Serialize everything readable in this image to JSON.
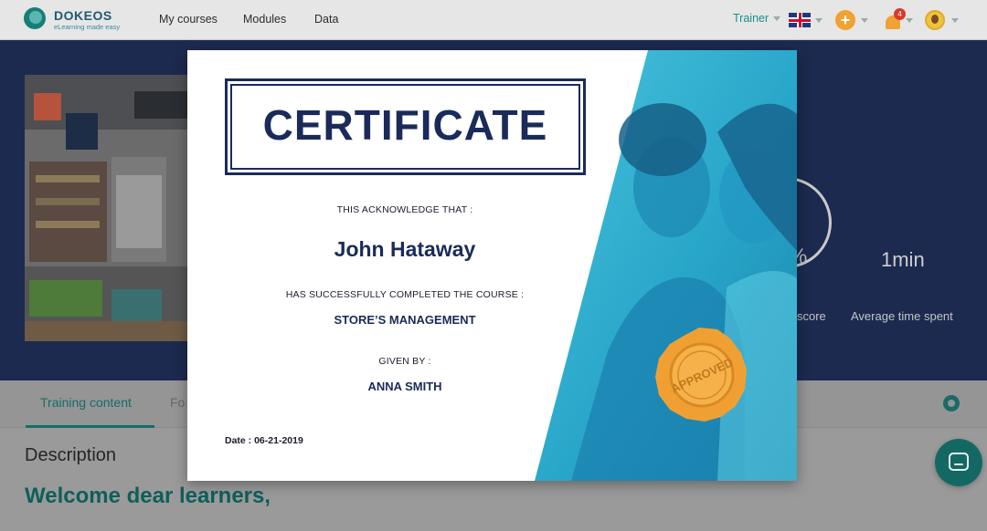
{
  "brand": {
    "name": "DOKEOS",
    "tagline": "eLearning made easy"
  },
  "nav": {
    "links": [
      "My courses",
      "Modules",
      "Data"
    ],
    "role": "Trainer",
    "notifications_count": "4"
  },
  "stats": {
    "score_symbol": "%",
    "score_label": "score",
    "avg_time_value": "1min",
    "avg_time_label": "Average time spent"
  },
  "tabs": {
    "active": "Training content",
    "second": "Fo"
  },
  "content": {
    "description_title": "Description",
    "welcome": "Welcome dear learners,"
  },
  "certificate": {
    "title": "CERTIFICATE",
    "ack_line": "THIS ACKNOWLEDGE THAT :",
    "recipient": "John Hataway",
    "completed_line": "HAS SUCCESSFULLY COMPLETED THE COURSE :",
    "course_name": "STORE’S MANAGEMENT",
    "given_line": "GIVEN BY :",
    "giver": "ANNA SMITH",
    "date_line": "Date : 06-21-2019",
    "seal_text": "APPROVED"
  },
  "colors": {
    "accent": "#1b8e88",
    "navy": "#1a2b59",
    "cyan": "#2bb3d4",
    "seal": "#f4a93a"
  }
}
